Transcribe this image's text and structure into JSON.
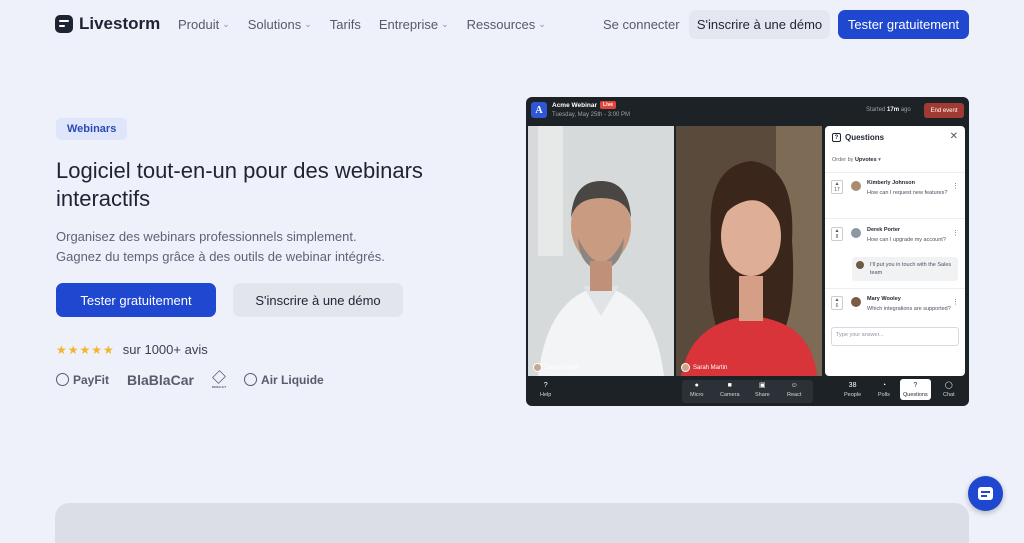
{
  "nav": {
    "brand": "Livestorm",
    "menu": [
      {
        "label": "Produit",
        "dropdown": true
      },
      {
        "label": "Solutions",
        "dropdown": true
      },
      {
        "label": "Tarifs",
        "dropdown": false
      },
      {
        "label": "Entreprise",
        "dropdown": true
      },
      {
        "label": "Ressources",
        "dropdown": true
      }
    ],
    "login": "Se connecter",
    "demo": "S'inscrire à une démo",
    "try": "Tester gratuitement"
  },
  "hero": {
    "badge": "Webinars",
    "title": "Logiciel tout-en-un pour des webinars interactifs",
    "subtitle_line1": "Organisez des webinars professionnels simplement.",
    "subtitle_line2": "Gagnez du temps grâce à des outils de webinar intégrés.",
    "cta_primary": "Tester gratuitement",
    "cta_secondary": "S'inscrire à une démo",
    "stars": "★★★★★",
    "rating": "sur 1000+ avis",
    "logos": [
      "PayFit",
      "BlaBlaCar",
      "RENAULT",
      "Air Liquide"
    ]
  },
  "app": {
    "avatar": "A",
    "event_title": "Acme Webinar",
    "live_badge": "Live",
    "date": "Tuesday, May 25th - 3:00 PM",
    "started_prefix": "Started",
    "started_value": "17m",
    "started_suffix": "ago",
    "end_button": "End event",
    "speakers": [
      "Daniel Smith",
      "Sarah Martin"
    ],
    "panel": {
      "title": "Questions",
      "order_prefix": "Order by",
      "order_value": "Upvotes",
      "questions": [
        {
          "votes": "17",
          "name": "Kimberly Johnson",
          "text": "How can I request new features?"
        },
        {
          "votes": "8",
          "name": "Derek Porter",
          "text": "How can I upgrade my account?",
          "reply": "I'll put you in touch with the Sales team"
        },
        {
          "votes": "6",
          "name": "Mary Wooley",
          "text": "Which integrations are supported?"
        }
      ],
      "answer_placeholder": "Type your answer..."
    },
    "controls": {
      "help": "Help",
      "micro": "Micro",
      "camera": "Camera",
      "share": "Share",
      "react": "React",
      "people_count": "38",
      "people": "People",
      "polls": "Polls",
      "questions": "Questions",
      "chat": "Chat"
    }
  },
  "colors": {
    "primary": "#1f47d0",
    "background": "#eef0fa",
    "text": "#1f2433",
    "star": "#f4b52a",
    "live": "#e2433a"
  }
}
